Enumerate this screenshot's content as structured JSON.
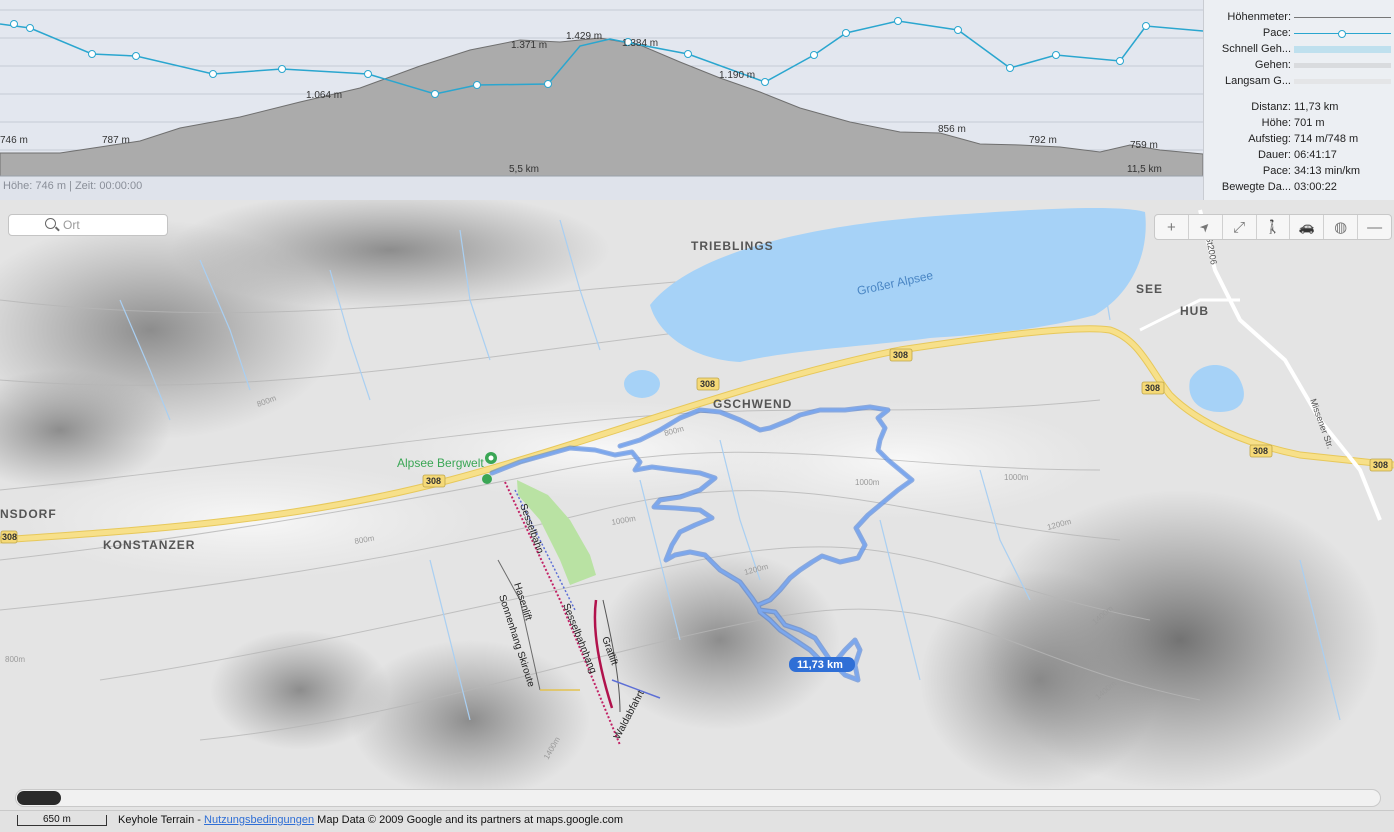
{
  "profile": {
    "elevation_labels": [
      "746 m",
      "787 m",
      "1.064 m",
      "1.371 m",
      "1.429 m",
      "1.384 m",
      "1.190 m",
      "856 m",
      "792 m",
      "759 m"
    ],
    "distance_labels": [
      "5,5 km",
      "11,5 km"
    ],
    "status": "Höhe: 746 m | Zeit: 00:00:00",
    "colors": {
      "altitude_fill": "#aeaeae",
      "pace_line": "#2aa6cf"
    }
  },
  "legend": {
    "items": [
      {
        "label": "Höhenmeter:",
        "style": "gray-line"
      },
      {
        "label": "Pace:",
        "style": "blue-line-marker"
      },
      {
        "label": "Schnell Geh...",
        "style": "light-blue-bar"
      },
      {
        "label": "Gehen:",
        "style": "light-gray-bar"
      },
      {
        "label": "Langsam G...",
        "style": "pale-gray-bar"
      }
    ]
  },
  "stats": [
    {
      "key": "Distanz:",
      "value": "11,73 km"
    },
    {
      "key": "Höhe:",
      "value": "701 m"
    },
    {
      "key": "Aufstieg:",
      "value": "714 m/748 m"
    },
    {
      "key": "Dauer:",
      "value": "06:41:17"
    },
    {
      "key": "Pace:",
      "value": "34:13 min/km"
    },
    {
      "key": "Bewegte Da...",
      "value": "03:00:22"
    }
  ],
  "search": {
    "placeholder": "Ort",
    "icon": "search-icon"
  },
  "toolbar": {
    "buttons": [
      {
        "icon": "zoom-plus-icon",
        "glyph": "+"
      },
      {
        "icon": "locate-arrow-icon",
        "glyph": "➤"
      },
      {
        "icon": "fullscreen-icon",
        "glyph": "⤢"
      },
      {
        "icon": "walking-icon",
        "glyph": "🚶"
      },
      {
        "icon": "car-icon",
        "glyph": "🚗"
      },
      {
        "icon": "globe-icon",
        "glyph": "◍"
      },
      {
        "icon": "zoom-minus-icon",
        "glyph": "—"
      }
    ]
  },
  "map": {
    "places": [
      "TRIEBLINGS",
      "SEE",
      "HUB",
      "GSCHWEND",
      "KONSTANZER",
      "NSDORF"
    ],
    "lake": "Großer Alpsee",
    "poi": "Alpsee Bergwelt",
    "roads": [
      "308",
      "308",
      "308",
      "308",
      "308",
      "308",
      "308"
    ],
    "road_side_label": "Missener Str.",
    "road_vertical_label": "St2006",
    "ski_lifts": [
      "Sesselbahn",
      "Sesselbahnhang",
      "Hasenlift",
      "Sonnenhang Skiroute",
      "Gratlift",
      "Waldabfahrt"
    ],
    "contours": [
      "800m",
      "800m",
      "800m",
      "1000m",
      "1000m",
      "1000m",
      "1200m",
      "1200m",
      "1400m",
      "1400m",
      "1400m",
      "800m"
    ],
    "track_distance": "11,73 km",
    "colors": {
      "track": "#5b8fe8",
      "lake": "#a6d2f7",
      "road": "#f5d977",
      "ski_run": "#b1124c",
      "forest": "#b9e2a3"
    }
  },
  "footer": {
    "scale_label": "650 m",
    "terrain_label": "Keyhole Terrain - ",
    "terms_link": "Nutzungsbedingungen",
    "copyright": " Map Data © 2009 Google and its partners at maps.google.com"
  }
}
